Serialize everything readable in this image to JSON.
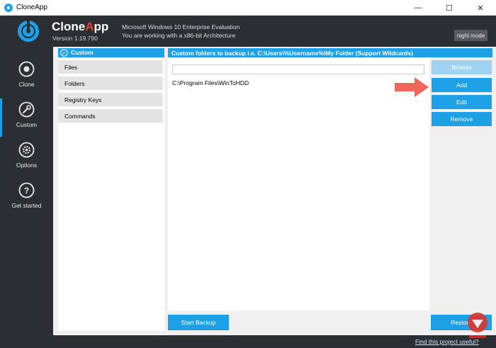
{
  "window": {
    "title": "CloneApp",
    "min_glyph": "—",
    "max_glyph": "☐",
    "close_glyph": "✕"
  },
  "header": {
    "app_name_main": "Clone",
    "app_name_accent": "A",
    "app_name_rest": "pp",
    "version": "Version 1.19.790",
    "os_info": "Microsoft Windows 10 Enterprise Evaluation",
    "arch_info": "You are working with a x86-bit Architecture",
    "night_mode_label": "night mode"
  },
  "sidebar": {
    "items": [
      {
        "label": "Clone",
        "icon": "disc-icon"
      },
      {
        "label": "Custom",
        "icon": "wrench-icon"
      },
      {
        "label": "Options",
        "icon": "gear-icon"
      },
      {
        "label": "Get started",
        "icon": "question-icon"
      }
    ],
    "active": "Custom"
  },
  "custom_panel": {
    "header": "Custom",
    "items": [
      "Files",
      "Folders",
      "Registry Keys",
      "Commands"
    ]
  },
  "folders_panel": {
    "header": "Custom folders to backup i.e. C:\\Users\\%Username%\\My Folder (Support Wildcards)",
    "input_value": "",
    "entries": [
      "C:\\Program Files\\WinToHDD"
    ]
  },
  "buttons": {
    "browse": "Browse",
    "add": "Add",
    "edit": "Edit",
    "remove": "Remove",
    "start_backup": "Start Backup",
    "restore": "Restore"
  },
  "status": {
    "link": "Find this project useful?"
  },
  "colors": {
    "accent": "#1ea0e6",
    "dark": "#2b2f33",
    "logo_accent": "#e8402a",
    "arrow": "#f0665a"
  }
}
